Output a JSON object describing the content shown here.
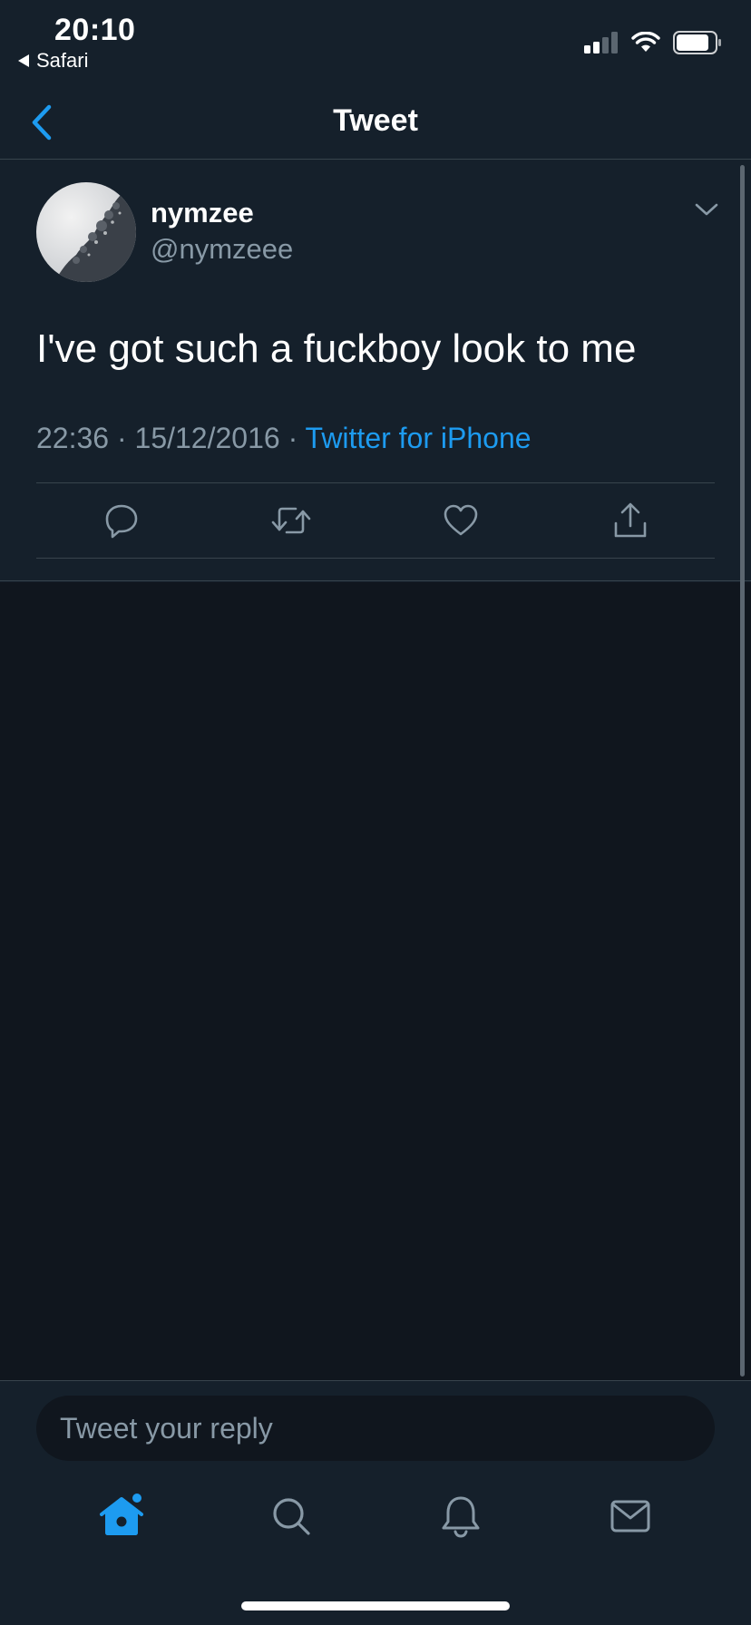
{
  "status_bar": {
    "time": "20:10",
    "back_app": "Safari",
    "icons": [
      "cellular-signal-icon",
      "wifi-icon",
      "battery-icon"
    ]
  },
  "nav": {
    "title": "Tweet",
    "back_icon": "chevron-left-icon"
  },
  "tweet": {
    "display_name": "nymzee",
    "handle": "@nymzeee",
    "text": "I've got such a fuckboy look to me",
    "time": "22:36",
    "date": "15/12/2016",
    "separator": "·",
    "source": "Twitter for iPhone",
    "actions": [
      "reply-icon",
      "retweet-icon",
      "like-icon",
      "share-icon"
    ]
  },
  "composer": {
    "placeholder": "Tweet your reply"
  },
  "tabbar": {
    "tabs": [
      "home-icon",
      "search-icon",
      "notifications-icon",
      "messages-icon"
    ]
  },
  "colors": {
    "background": "#15202b",
    "background_dark": "#10161e",
    "accent": "#1d9bf0",
    "secondary_text": "#8899a6",
    "divider": "#38444d"
  }
}
